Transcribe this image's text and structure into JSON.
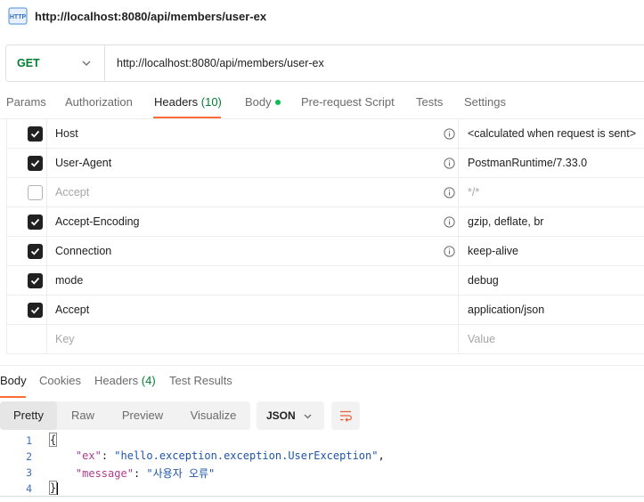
{
  "request": {
    "title": "http://localhost:8080/api/members/user-ex",
    "icon": "http-file-icon",
    "method": "GET",
    "method_color": "#007f31",
    "url": "http://localhost:8080/api/members/user-ex"
  },
  "request_tabs": [
    {
      "label": "Params"
    },
    {
      "label": "Authorization"
    },
    {
      "label": "Headers",
      "count": "(10)",
      "active": true
    },
    {
      "label": "Body",
      "indicator": "green-dot"
    },
    {
      "label": "Pre-request Script"
    },
    {
      "label": "Tests"
    },
    {
      "label": "Settings"
    }
  ],
  "headers": [
    {
      "key": "Host",
      "value": "<calculated when request is sent>",
      "checked": true,
      "info": true
    },
    {
      "key": "User-Agent",
      "value": "PostmanRuntime/7.33.0",
      "checked": true,
      "info": true
    },
    {
      "key": "Accept",
      "value": "*/*",
      "checked": false,
      "info": true
    },
    {
      "key": "Accept-Encoding",
      "value": "gzip, deflate, br",
      "checked": true,
      "info": true
    },
    {
      "key": "Connection",
      "value": "keep-alive",
      "checked": true,
      "info": true
    },
    {
      "key": "mode",
      "value": "debug",
      "checked": true,
      "info": false
    },
    {
      "key": "Accept",
      "value": "application/json",
      "checked": true,
      "info": false
    }
  ],
  "new_header": {
    "key_placeholder": "Key",
    "value_placeholder": "Value"
  },
  "response_tabs": [
    {
      "label": "Body",
      "active": true
    },
    {
      "label": "Cookies"
    },
    {
      "label": "Headers",
      "count": "(4)"
    },
    {
      "label": "Test Results"
    }
  ],
  "view_modes": [
    "Pretty",
    "Raw",
    "Preview",
    "Visualize"
  ],
  "active_view": "Pretty",
  "format": "JSON",
  "code_lines": [
    {
      "n": "1",
      "text": "{"
    },
    {
      "n": "2",
      "key": "\"ex\"",
      "value": "\"hello.exception.exception.UserException\"",
      "trail": ","
    },
    {
      "n": "3",
      "key": "\"message\"",
      "value": "\"사용자 오류\"",
      "trail": ""
    },
    {
      "n": "4",
      "text": "}"
    }
  ],
  "colors": {
    "accent": "#ff6c37",
    "count_green": "#007f31",
    "dot_green": "#0cbb52",
    "json_key": "#b03a8c",
    "json_string": "#1f55a8"
  }
}
